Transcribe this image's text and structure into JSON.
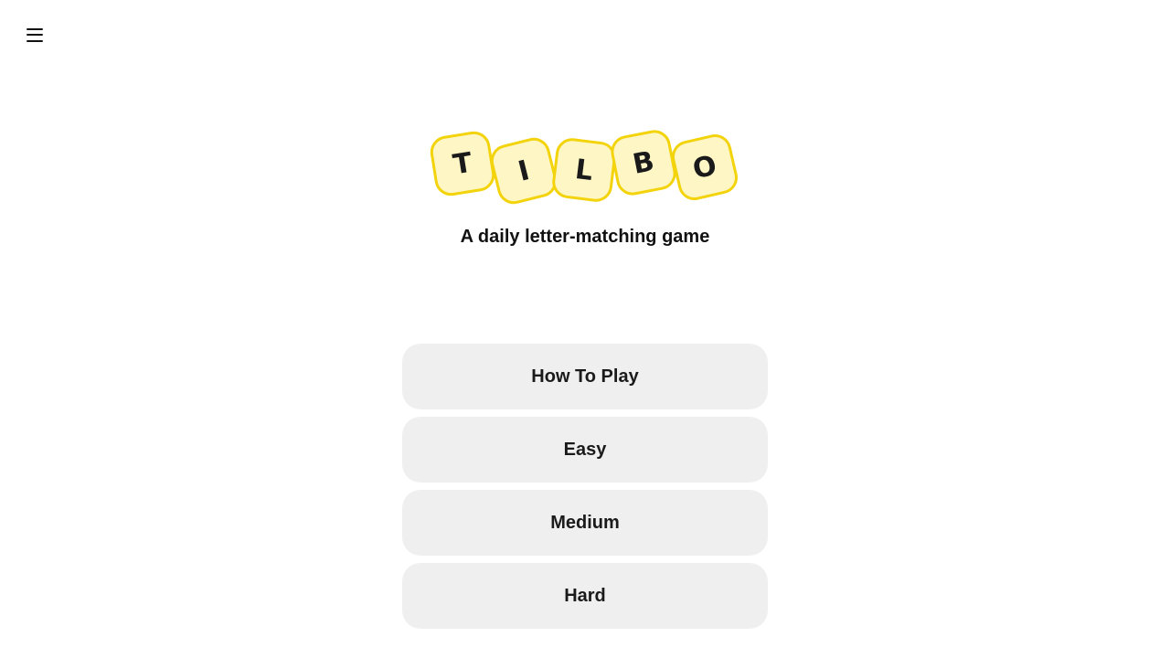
{
  "menu": {
    "icon": "hamburger-menu-icon"
  },
  "logo": {
    "letters": [
      "T",
      "I",
      "L",
      "B",
      "O"
    ],
    "tile_fill": "#fff6c6",
    "tile_border": "#f3d30c"
  },
  "tagline": "A daily letter-matching game",
  "options": [
    {
      "label": "How To Play"
    },
    {
      "label": "Easy"
    },
    {
      "label": "Medium"
    },
    {
      "label": "Hard"
    }
  ]
}
